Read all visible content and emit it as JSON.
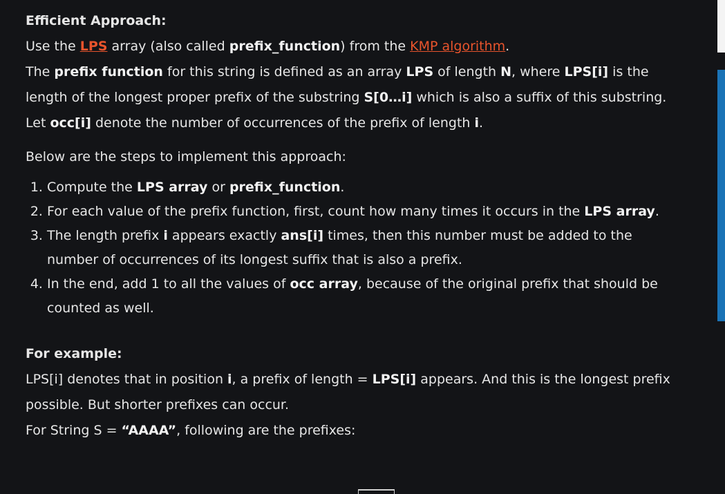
{
  "heading1": "Efficient Approach:",
  "intro": {
    "t1": "Use the ",
    "lps_link": "LPS",
    "t2": " array (also called ",
    "b1": "prefix_function",
    "t3": ") from the ",
    "kmp_link": "KMP algorithm",
    "t4": "."
  },
  "definition": {
    "t1": "The ",
    "b1": "prefix function",
    "t2": " for this string is defined as an array ",
    "b2": "LPS",
    "t3": " of length ",
    "b3": "N",
    "t4": ", where ",
    "b4": "LPS[i]",
    "t5": " is the length of the longest proper prefix of the substring ",
    "b5": "S[0…i]",
    "t6": " which is also a suffix of this substring. Let ",
    "b6": "occ[i]",
    "t7": " denote the number of occurrences of the prefix of length ",
    "b7": "i",
    "t8": "."
  },
  "steps_intro": "Below are the steps to implement this approach:",
  "steps": [
    {
      "t1": "Compute the ",
      "b1": "LPS array",
      "t2": " or ",
      "b2": "prefix_function",
      "t3": "."
    },
    {
      "t1": "For each value of the prefix function, first, count how many times it occurs in the ",
      "b1": "LPS array",
      "t2": "."
    },
    {
      "t1": "The length prefix ",
      "b1": "i",
      "t2": " appears exactly ",
      "b2": "ans[i]",
      "t3": " times, then this number must be added to the number of occurrences of its longest suffix that is also a prefix."
    },
    {
      "t1": "In the end, add 1 to all the values of ",
      "b1": "occ array",
      "t2": ", because of the original prefix that should be counted as well."
    }
  ],
  "heading2": "For example:",
  "example": {
    "t1": "LPS[i] denotes that in position ",
    "b1": "i",
    "t2": ", a prefix of length = ",
    "b2": "LPS[i]",
    "t3": " appears. And this is the longest prefix possible. But shorter prefixes can occur."
  },
  "example2": {
    "t1": "For String S = ",
    "b1": "“AAAA”",
    "t2": ", following are the prefixes:"
  },
  "colors": {
    "background": "#131417",
    "text": "#e6e6e6",
    "link": "#e8542c",
    "scrollbar": "#1a73b6"
  }
}
